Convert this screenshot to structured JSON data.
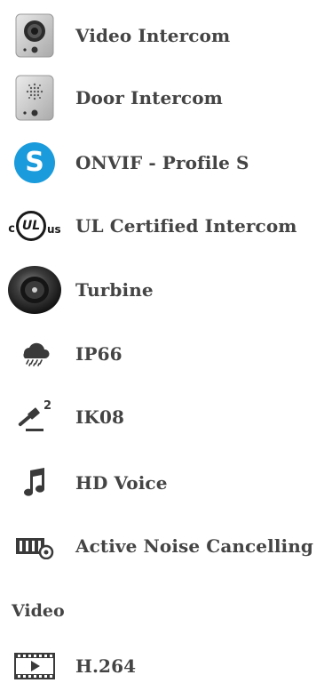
{
  "features": [
    {
      "label": "Video Intercom",
      "icon": "video-intercom-icon"
    },
    {
      "label": "Door Intercom",
      "icon": "door-intercom-icon"
    },
    {
      "label": "ONVIF - Profile S",
      "icon": "onvif-s-icon"
    },
    {
      "label": "UL Certified Intercom",
      "icon": "ul-certified-icon"
    },
    {
      "label": "Turbine",
      "icon": "turbine-icon"
    },
    {
      "label": "IP66",
      "icon": "rain-cloud-icon"
    },
    {
      "label": "IK08",
      "icon": "hammer-icon"
    },
    {
      "label": "HD Voice",
      "icon": "music-note-icon"
    },
    {
      "label": "Active Noise Cancelling",
      "icon": "noise-cancelling-icon"
    }
  ],
  "video_section": {
    "heading": "Video",
    "items": [
      {
        "label": "H.264",
        "icon": "video-play-icon"
      }
    ]
  },
  "icon_text": {
    "onvif_letter": "S",
    "ul_c": "c",
    "ul_mark": "UL",
    "ul_us": "us",
    "ik_superscript": "2"
  },
  "colors": {
    "text": "#444444",
    "onvif_blue": "#1a9bdc",
    "icon_dark": "#3a3a3a"
  }
}
